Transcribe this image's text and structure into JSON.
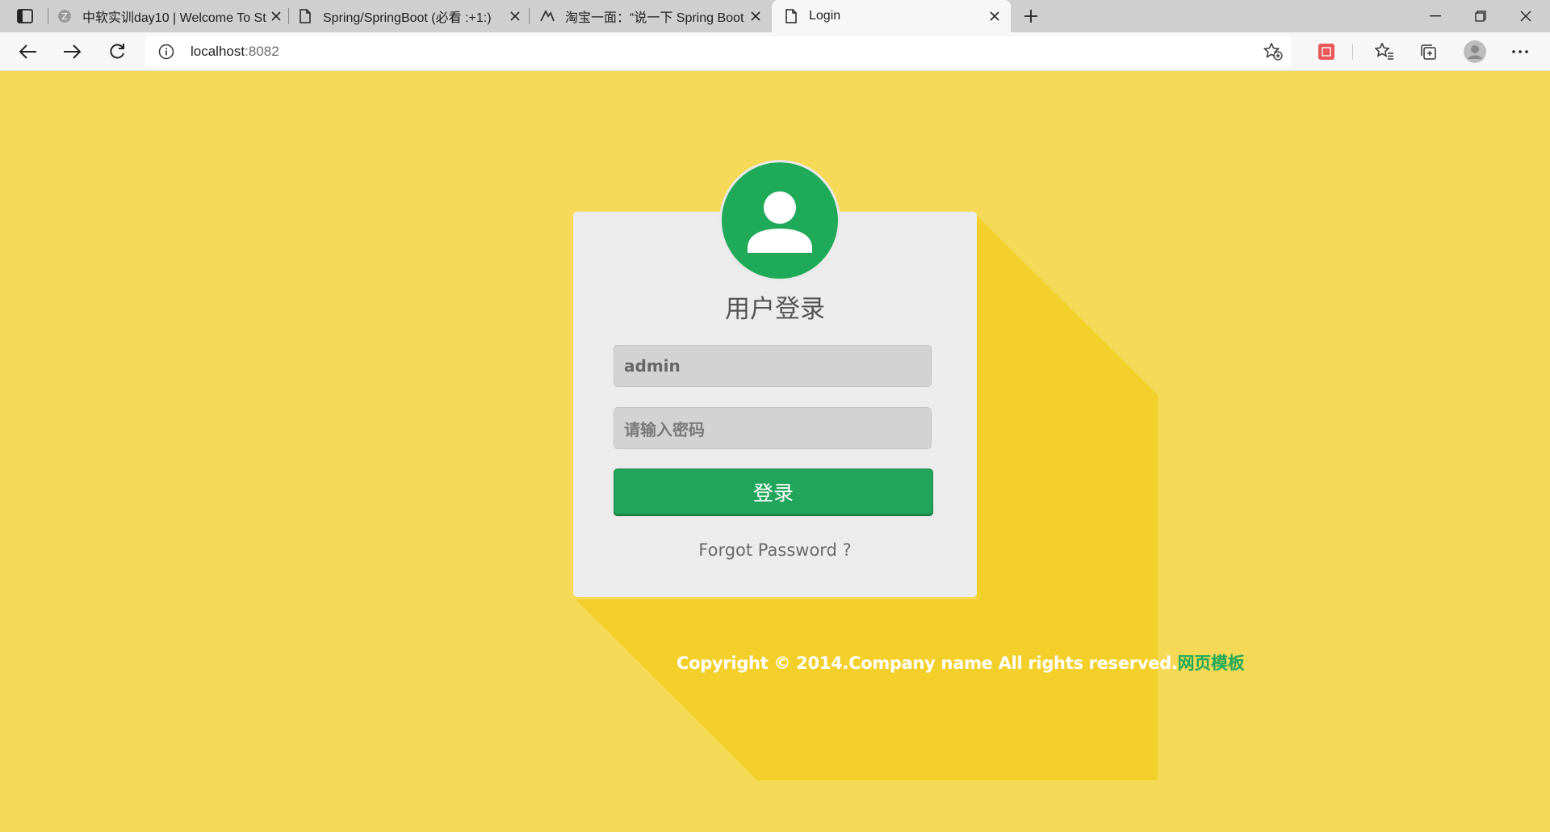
{
  "browser": {
    "tabs": [
      {
        "title": "中软实训day10 | Welcome To Stu",
        "icon": "site-icon"
      },
      {
        "title": "Spring/SpringBoot (必看 :+1:)",
        "icon": "page-icon"
      },
      {
        "title": "淘宝一面：“说一下 Spring Boot",
        "icon": "site-icon"
      },
      {
        "title": "Login",
        "icon": "page-icon"
      }
    ],
    "address": {
      "host": "localhost",
      "port": ":8082"
    }
  },
  "login": {
    "title": "用户登录",
    "username_value": "admin",
    "password_placeholder": "请输入密码",
    "submit_label": "登录",
    "forgot_label": "Forgot Password ?"
  },
  "footer": {
    "copyright": "Copyright © 2014.Company name All rights reserved.",
    "template_link": "网页模板"
  },
  "colors": {
    "page_bg": "#f5d957",
    "shadow": "#f3d029",
    "accent_green": "#1faa59",
    "card_bg": "#ececec"
  }
}
